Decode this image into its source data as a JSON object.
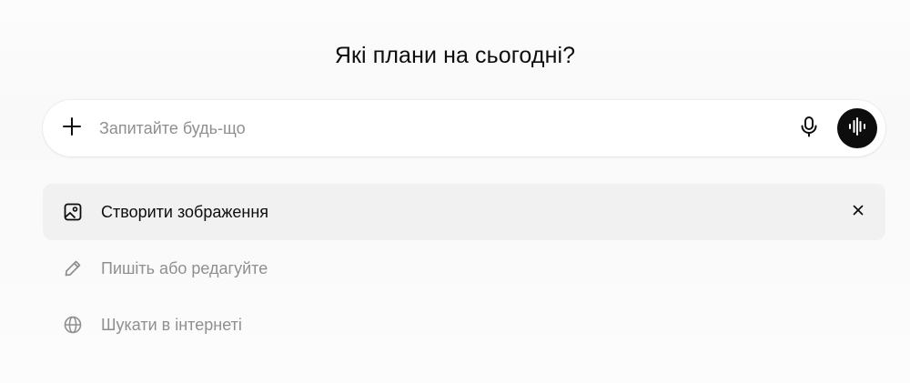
{
  "heading": "Які плани на сьогодні?",
  "composer": {
    "placeholder": "Запитайте будь-що",
    "value": "",
    "icons": {
      "add": "plus-icon",
      "dictate": "microphone-icon",
      "voice_mode": "voice-waveform-icon"
    },
    "voice_button_color": "#0d0d0d"
  },
  "suggestions": [
    {
      "label": "Створити зображення",
      "icon": "image-icon",
      "selected": true,
      "dismiss_icon": "close-icon"
    },
    {
      "label": "Пишіть або редагуйте",
      "icon": "pencil-icon",
      "selected": false
    },
    {
      "label": "Шукати в інтернеті",
      "icon": "globe-icon",
      "selected": false
    }
  ],
  "colors": {
    "text_primary": "#0d0d0d",
    "text_muted": "#8f8f8f",
    "selected_row_bg": "#f1f1f1"
  }
}
